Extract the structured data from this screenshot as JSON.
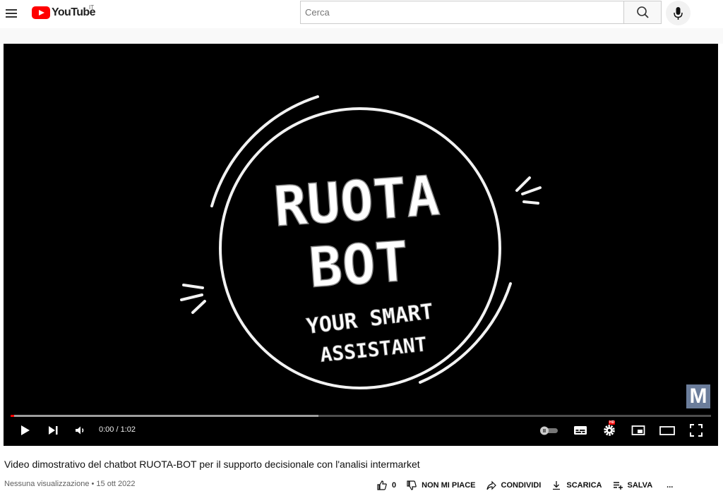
{
  "header": {
    "logo_text": "YouTube",
    "country_code": "IT",
    "search_placeholder": "Cerca"
  },
  "player": {
    "time": "0:00 / 1:02",
    "progress_played": 0.0,
    "progress_buffered": 0.44,
    "video_art": {
      "line1": "RUOTA",
      "line2": "BOT",
      "line3": "YOUR SMART",
      "line4": "ASSISTANT"
    },
    "watermark": "M",
    "hd_badge": "HD"
  },
  "video": {
    "title": "Video dimostrativo del chatbot RUOTA-BOT per il supporto decisionale con l'analisi intermarket",
    "meta": "Nessuna visualizzazione • 15 ott 2022"
  },
  "actions": {
    "like_count": "0",
    "dislike_label": "NON MI PIACE",
    "share_label": "CONDIVIDI",
    "download_label": "SCARICA",
    "save_label": "SALVA",
    "more_label": "..."
  },
  "colors": {
    "brand_red": "#ff0000",
    "player_bg": "#000000",
    "text_primary": "#0f0f0f",
    "text_secondary": "#606060"
  }
}
